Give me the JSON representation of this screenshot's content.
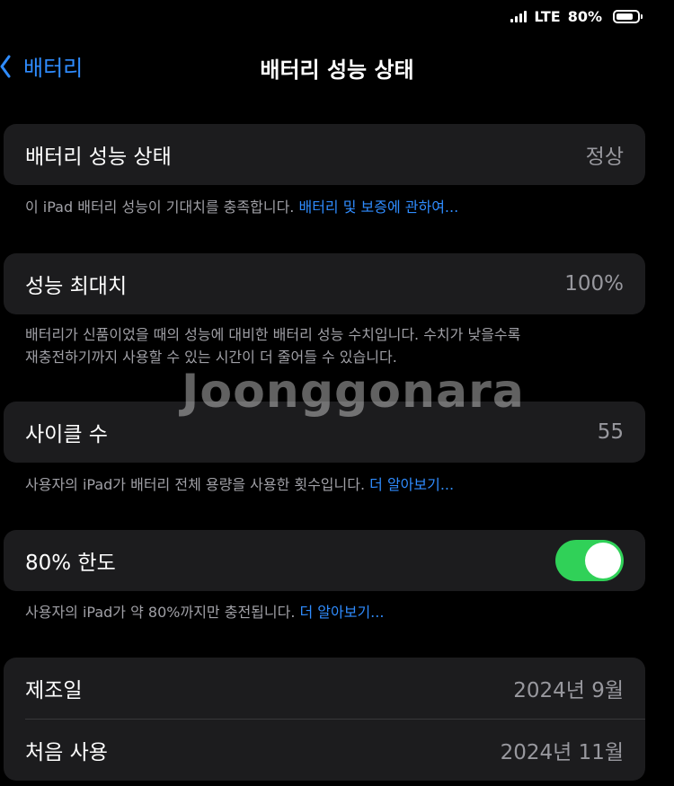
{
  "status_bar": {
    "network": "LTE",
    "battery_percent": "80%",
    "battery_level": 0.8
  },
  "nav": {
    "back_label": "배터리",
    "title": "배터리 성능 상태"
  },
  "health": {
    "label": "배터리 성능 상태",
    "value": "정상",
    "footer_text": "이 iPad 배터리 성능이 기대치를 충족합니다. ",
    "footer_link": "배터리 및 보증에 관하여..."
  },
  "max_capacity": {
    "label": "성능 최대치",
    "value": "100%",
    "footer_line1": "배터리가 신품이었을 때의 성능에 대비한 배터리 성능 수치입니다. 수치가 낮을수록",
    "footer_line2": "재충전하기까지 사용할 수 있는 시간이 더 줄어들 수 있습니다."
  },
  "cycle_count": {
    "label": "사이클 수",
    "value": "55",
    "footer_text": "사용자의 iPad가 배터리 전체 용량을 사용한 횟수입니다. ",
    "footer_link": "더 알아보기..."
  },
  "limit": {
    "label": "80% 한도",
    "enabled": true,
    "footer_text": "사용자의 iPad가 약 80%까지만 충전됩니다. ",
    "footer_link": "더 알아보기..."
  },
  "dates": {
    "manufactured_label": "제조일",
    "manufactured_value": "2024년 9월",
    "first_use_label": "처음 사용",
    "first_use_value": "2024년 11월"
  },
  "watermark": {
    "text": "Joonggonara"
  },
  "colors": {
    "accent": "#2f8cff",
    "toggle_on": "#30d158",
    "cell_background": "#1c1c1e"
  }
}
